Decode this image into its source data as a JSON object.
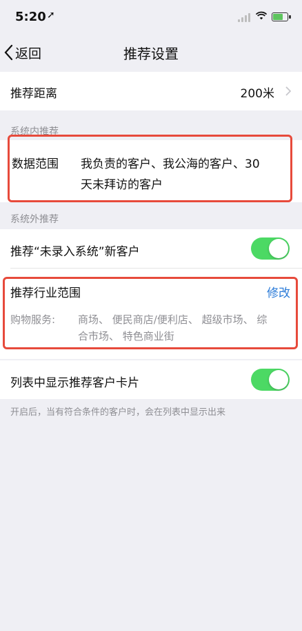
{
  "status_bar": {
    "time": "5:20",
    "location_icon": "arrow-icon"
  },
  "navbar": {
    "back_label": "返回",
    "title": "推荐设置"
  },
  "distance": {
    "label": "推荐距离",
    "value": "200米"
  },
  "internal": {
    "section_title": "系统内推荐",
    "data_range_label": "数据范围",
    "data_range_value_line1": "我负责的客户、我公海的客户、30",
    "data_range_value_line2": "天未拜访的客户"
  },
  "external": {
    "section_title": "系统外推荐",
    "recommend_new_label": "推荐“未录入系统”新客户",
    "industry_title": "推荐行业范围",
    "edit_label": "修改",
    "category_label": "购物服务:",
    "category_values_line1": "商场、 便民商店/便利店、 超级市场、 综",
    "category_values_line2": "合市场、 特色商业街"
  },
  "list_card": {
    "label": "列表中显示推荐客户卡片",
    "footnote": "开启后，当有符合条件的客户时，会在列表中显示出来"
  },
  "colors": {
    "toggle_on": "#4cd964",
    "highlight": "#e74a3b",
    "link": "#2b7bd8"
  }
}
